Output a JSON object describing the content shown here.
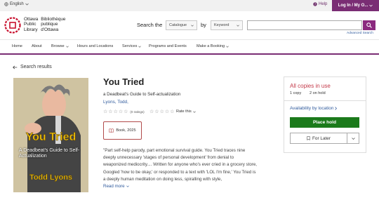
{
  "topbar": {
    "language": "English",
    "help": "Help",
    "login": "Log In / My O..."
  },
  "logo": {
    "line1_en": "Ottawa",
    "line2_en": "Public",
    "line3_en": "Library",
    "line1_fr": "Bibliothèque",
    "line2_fr": "publique",
    "line3_fr": "d'Ottawa"
  },
  "search": {
    "label": "Search the",
    "catalogue_option": "Catalogue",
    "by_label": "by",
    "keyword_option": "Keyword",
    "input_value": "",
    "advanced": "Advanced Search"
  },
  "nav": {
    "items": [
      {
        "label": "Home",
        "dropdown": false
      },
      {
        "label": "About",
        "dropdown": false
      },
      {
        "label": "Browse",
        "dropdown": true
      },
      {
        "label": "Hours and Locations",
        "dropdown": false
      },
      {
        "label": "Services",
        "dropdown": true
      },
      {
        "label": "Programs and Events",
        "dropdown": false
      },
      {
        "label": "Make a Booking",
        "dropdown": true
      }
    ]
  },
  "back_link": "Search results",
  "cover": {
    "title": "You Tried",
    "subtitle": "A Deadbeat's Guide to Self-Actualization",
    "author": "Todd Lyons"
  },
  "item": {
    "title": "You Tried",
    "subtitle": "a Deadbeat's Guide to Self-actualization",
    "author": "Lyons, Todd,",
    "rating_count": "(0 ratings)",
    "rate_this": "Rate this",
    "format": "Book, 2025",
    "description": "\"Part self-help parody, part emotional survival guide. You Tried traces nine deeply unnecessary 'stages of personal development' from denial to weaponized mediocrity.... Written for anyone who's ever cried in a grocery store, Googled 'how to be okay,' or responded to a text with 'LOL I'm fine,' You Tried is a deeply human meditation on doing less, spiralling with style,",
    "read_more": "Read more"
  },
  "availability": {
    "status": "All copies in use",
    "copies": "1 copy",
    "holds": "2 on hold",
    "location_link": "Availability by location",
    "place_hold": "Place hold",
    "for_later": "For Later"
  },
  "colors": {
    "brand_purple": "#7a2d74",
    "status_red": "#c43a4a",
    "hold_green": "#1b7a1b",
    "link_blue": "#2f5a9c"
  }
}
